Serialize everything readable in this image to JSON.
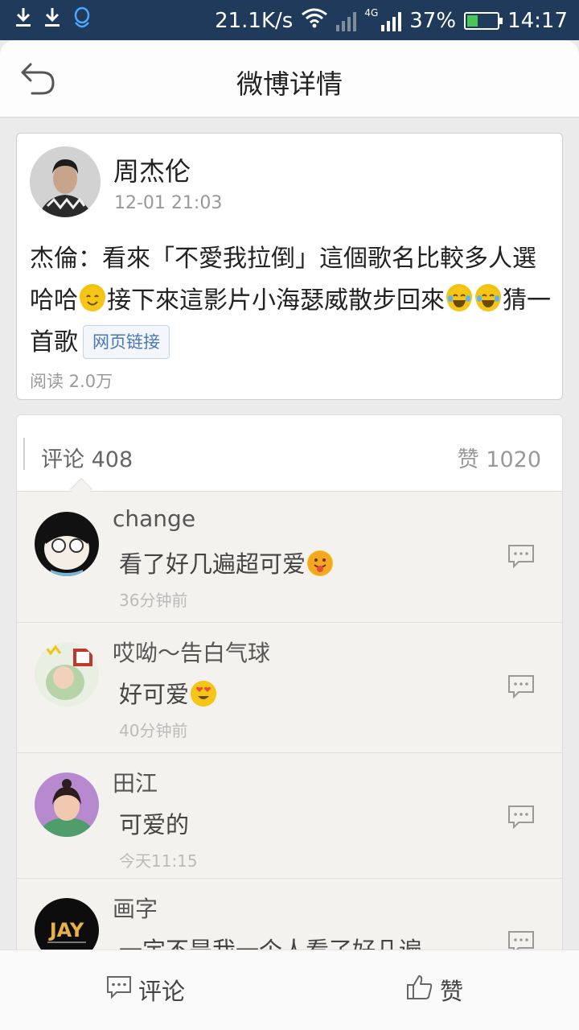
{
  "status_bar": {
    "net_speed": "21.1K/s",
    "network_type": "4G",
    "battery": "37%",
    "battery_level": 0.37,
    "time": "14:17",
    "icons": [
      "download-icon",
      "download-icon",
      "qq-icon",
      "wifi-icon",
      "signal-icon",
      "battery-icon"
    ]
  },
  "header": {
    "title": "微博详情",
    "back_icon": "back-arrow-icon"
  },
  "post": {
    "author": "周杰伦",
    "time": "12-01 21:03",
    "text_1": "杰倫：看來「不愛我拉倒」這個歌名比較多人選哈哈",
    "text_2": "接下來這影片小海瑟威散步回來",
    "text_3": "猜一首歌",
    "link_label": "网页链接",
    "reads": "阅读 2.0万"
  },
  "comments_panel": {
    "count_label": "评论 408",
    "likes_label": "赞 1020",
    "items": [
      {
        "name": "change",
        "text": "看了好几遍超可爱",
        "time": "36分钟前"
      },
      {
        "name": "哎呦～告白气球",
        "text": "好可爱",
        "time": "40分钟前"
      },
      {
        "name": "田江",
        "text": "可爱的",
        "time": "今天11:15"
      },
      {
        "name": "画字",
        "text": "一定不是我一个人看了好几遍",
        "time": ""
      }
    ]
  },
  "bottom_bar": {
    "comment_label": "评论",
    "like_label": "赞"
  },
  "colors": {
    "status_bar_bg": "#1f3a5a",
    "link_blue": "#4a77b5",
    "page_bg": "#ebebeb"
  }
}
